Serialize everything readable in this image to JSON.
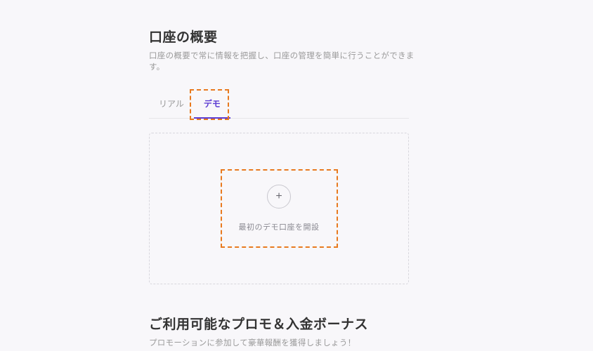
{
  "overview": {
    "title": "口座の概要",
    "subtitle": "口座の概要で常に情報を把握し、口座の管理を簡単に行うことができます。"
  },
  "tabs": {
    "real": "リアル",
    "demo": "デモ"
  },
  "create": {
    "plus": "+",
    "label": "最初のデモ口座を開設"
  },
  "promo": {
    "title": "ご利用可能なプロモ＆入金ボーナス",
    "subtitle": "プロモーションに参加して豪華報酬を獲得しましょう！"
  }
}
